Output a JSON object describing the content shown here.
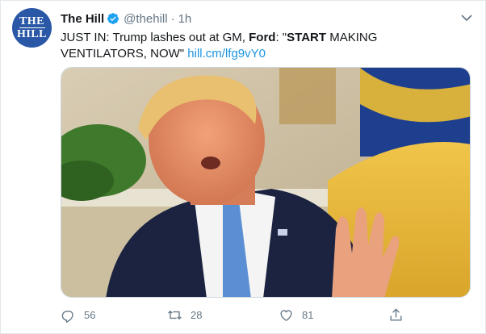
{
  "account": {
    "name": "The Hill",
    "handle": "@thehill",
    "separator": "·",
    "time": "1h",
    "avatar_text_line1": "THE",
    "avatar_text_line2": "HILL"
  },
  "tweet": {
    "text_prefix": "JUST IN: Trump lashes out at GM, ",
    "text_bold1": "Ford",
    "text_mid": ": \"",
    "text_bold2": "START",
    "text_suffix": " MAKING VENTILATORS, NOW\" ",
    "link": "hill.cm/lfg9vY0"
  },
  "actions": {
    "replies": "56",
    "retweets": "28",
    "likes": "81"
  },
  "icons": {
    "verified": "verified-badge-icon",
    "menu": "chevron-down-icon",
    "reply": "reply-icon",
    "retweet": "retweet-icon",
    "like": "heart-icon",
    "share": "share-icon"
  },
  "colors": {
    "brand_blue": "#1da1f2",
    "link": "#1b95e0",
    "muted": "#657786",
    "avatar_bg": "#2a58a6"
  }
}
